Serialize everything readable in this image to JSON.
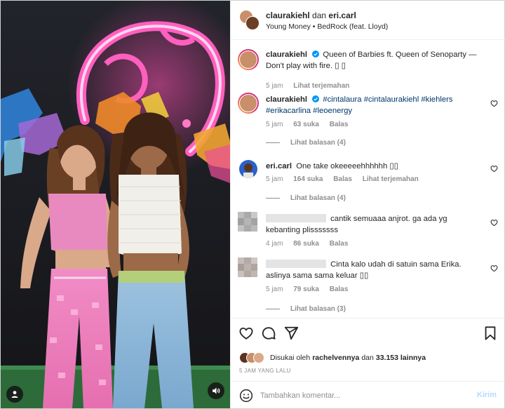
{
  "header": {
    "title_user1": "claurakiehl",
    "title_join": "dan",
    "title_user2": "eri.carl",
    "subtitle": "Young Money • BedRock (feat. Lloyd)"
  },
  "comments": [
    {
      "username": "claurakiehl",
      "text": "Queen of Barbies ft. Queen of Senoparty — Don't play with fire. ▯ ▯",
      "time": "5 jam",
      "translate": "Lihat terjemahan"
    },
    {
      "username": "claurakiehl",
      "hashtags": "#cintalaura #cintalaurakiehl #kiehlers #erikacarlina #leoenergy",
      "time": "5 jam",
      "likes": "63 suka",
      "reply": "Balas",
      "view_replies": "Lihat balasan (4)"
    },
    {
      "username": "eri.carl",
      "text": "One take okeeeeehhhhhh ▯▯",
      "time": "5 jam",
      "likes": "164 suka",
      "reply": "Balas",
      "translate": "Lihat terjemahan",
      "view_replies": "Lihat balasan (4)"
    },
    {
      "text": "cantik semuaaa anjrot. ga ada yg kebanting plisssssss",
      "time": "4 jam",
      "likes": "86 suka",
      "reply": "Balas"
    },
    {
      "text": "Cinta kalo udah di satuin sama Erika. aslinya sama sama keluar ▯▯",
      "time": "5 jam",
      "likes": "79 suka",
      "reply": "Balas",
      "view_replies": "Lihat balasan (3)"
    }
  ],
  "likes": {
    "prefix": "Disukai oleh",
    "user": "rachelvennya",
    "mid": "dan",
    "count": "33.153 lainnya"
  },
  "time_ago": "5 JAM YANG LALU",
  "add_comment": {
    "placeholder": "Tambahkan komentar...",
    "post": "Kirim"
  },
  "icons": {
    "like": "heart-icon",
    "comment": "comment-icon",
    "share": "paper-plane-icon",
    "save": "bookmark-icon",
    "emoji": "smiley-icon",
    "user_tag": "person-icon",
    "audio": "speaker-icon"
  },
  "colors": {
    "link": "#00376b",
    "muted": "#8e8e8e",
    "verified": "#0095f6",
    "post_disabled": "#b3dbff"
  }
}
